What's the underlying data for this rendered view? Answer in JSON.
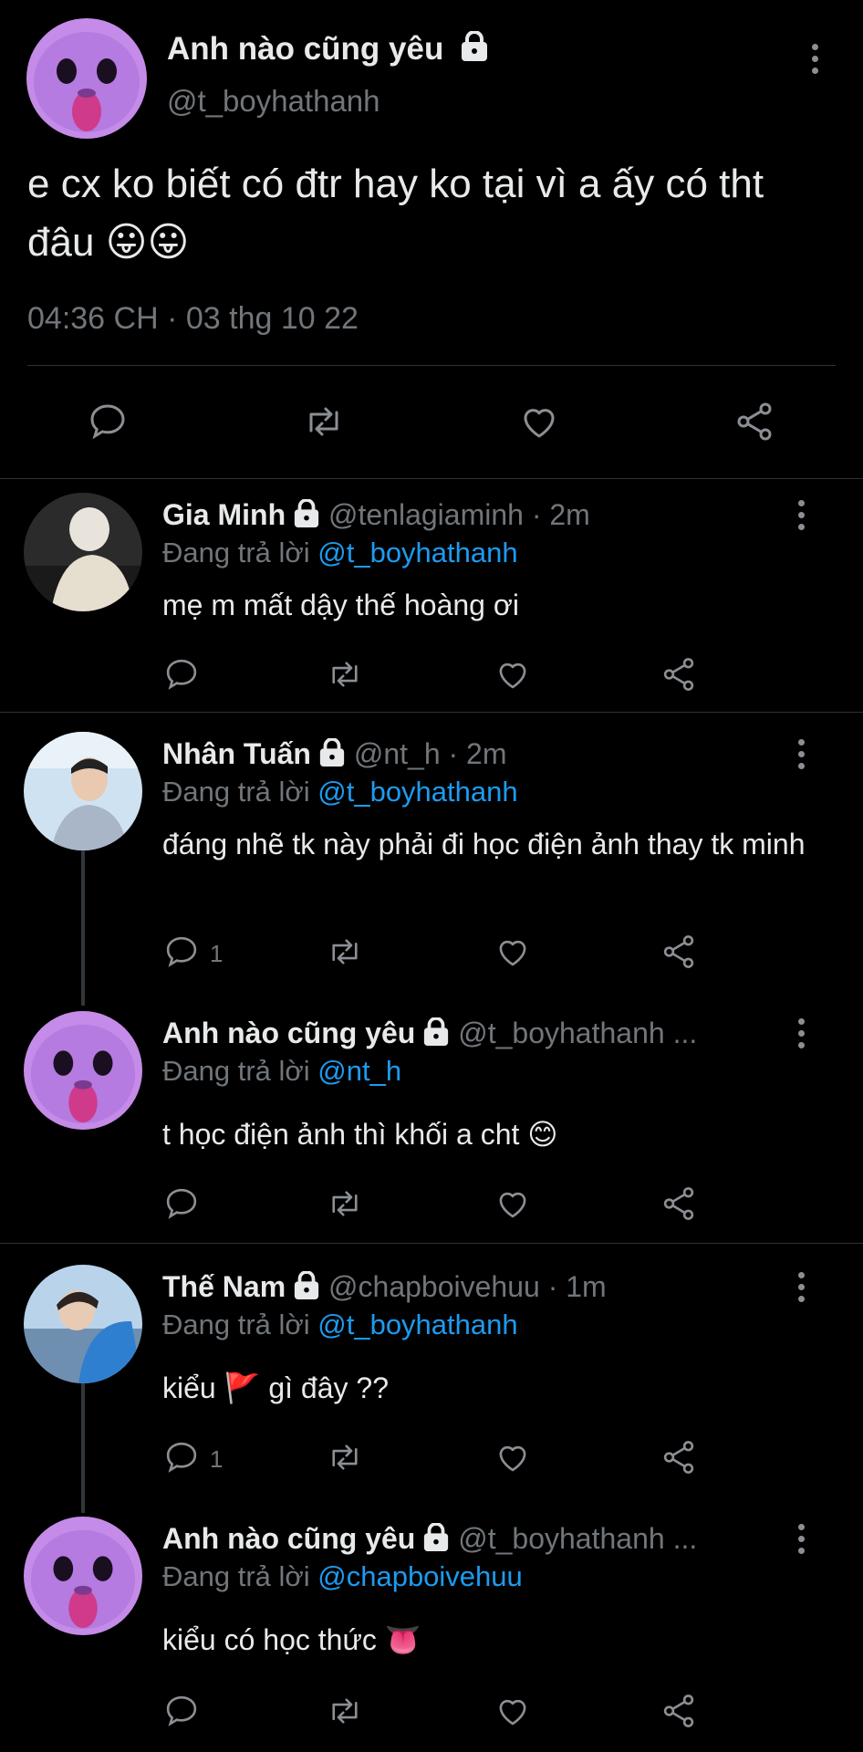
{
  "main_tweet": {
    "display_name": "Anh nào cũng yêu",
    "handle": "@t_boyhathanh",
    "text": "e cx ko biết có đtr hay ko tại vì a ấy có tht đâu 😛😛",
    "timestamp": "04:36 CH · 03 thg 10 22"
  },
  "replies": [
    {
      "display_name": "Gia Minh",
      "handle_meta": "@tenlagiaminh · 2m",
      "replying_prefix": "Đang trả lời",
      "replying_to": "@t_boyhathanh",
      "text": "mẹ m mất dậy thế hoàng ơi",
      "reply_count": ""
    },
    {
      "display_name": "Nhân Tuấn",
      "handle_meta": "@nt_h · 2m",
      "replying_prefix": "Đang trả lời",
      "replying_to": "@t_boyhathanh",
      "text": "đáng nhẽ tk này phải đi học điện ảnh thay tk minh",
      "reply_count": "1"
    },
    {
      "display_name": "Anh nào cũng yêu",
      "handle_meta": "@t_boyhathanh ...",
      "replying_prefix": "Đang trả lời",
      "replying_to": "@nt_h",
      "text": "t học điện ảnh thì khối a cht 😊",
      "reply_count": ""
    },
    {
      "display_name": "Thế Nam",
      "handle_meta": "@chapboivehuu · 1m",
      "replying_prefix": "Đang trả lời",
      "replying_to": "@t_boyhathanh",
      "text": "kiểu 🚩 gì đây ??",
      "reply_count": "1"
    },
    {
      "display_name": "Anh nào cũng yêu",
      "handle_meta": "@t_boyhathanh ...",
      "replying_prefix": "Đang trả lời",
      "replying_to": "@chapboivehuu",
      "text": "kiểu có học thức 👅",
      "reply_count": ""
    }
  ],
  "icons": {
    "reply": "reply-icon",
    "retweet": "retweet-icon",
    "like": "like-icon",
    "share": "share-icon",
    "lock": "lock-icon",
    "more": "more-icon"
  },
  "colors": {
    "background": "#000000",
    "text": "#e7e9ea",
    "muted": "#71767b",
    "link": "#1d9bf0",
    "divider": "#2f3336"
  }
}
